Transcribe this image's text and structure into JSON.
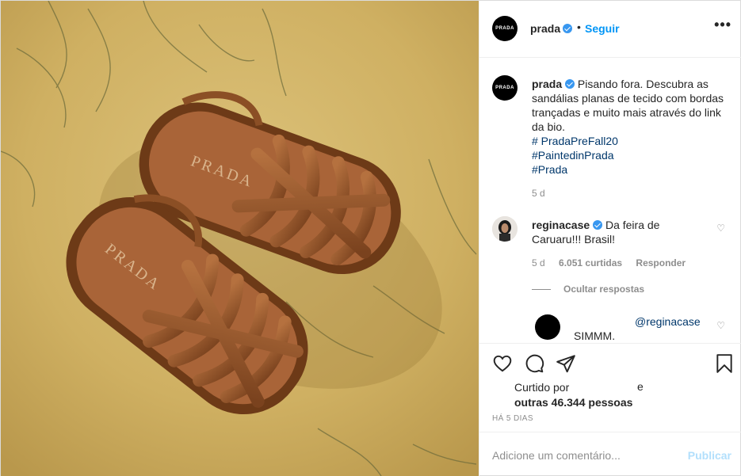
{
  "post": {
    "author": "prada",
    "avatar_text": "PRADA",
    "follow_label": "Seguir",
    "dot": "•",
    "more_label": "•••",
    "caption": {
      "text": "Pisando fora. Descubra as sandálias planas de tecido com bordas trançadas e muito mais através do link da bio.",
      "hashtags": [
        "# PradaPreFall20",
        "#PaintedinPrada",
        "#Prada"
      ],
      "time": "5 d"
    },
    "comments": [
      {
        "user": "reginacase",
        "text": "Da feira de Caruaru!!! Brasil!",
        "time": "5 d",
        "likes": "6.051 curtidas",
        "reply_label": "Responder",
        "hide_replies_label": "Ocultar respostas",
        "reply": {
          "mention": "@reginacase",
          "text": "SIMMM."
        }
      }
    ],
    "likes": {
      "prefix": "Curtido por",
      "suffix": "e",
      "others": "outras 46.344 pessoas"
    },
    "time_ago": "HÁ 5 DIAS",
    "add_comment_placeholder": "Adicione um comentário...",
    "publish_label": "Publicar",
    "colors": {
      "accent": "#0095f6",
      "verified": "#3897f0",
      "muted": "#8e8e8e",
      "hashtag": "#00376b",
      "publish_disabled": "#b2dffc"
    },
    "icons": [
      "heart-icon",
      "comment-icon",
      "share-icon",
      "bookmark-icon",
      "more-icon",
      "verified-icon"
    ]
  }
}
